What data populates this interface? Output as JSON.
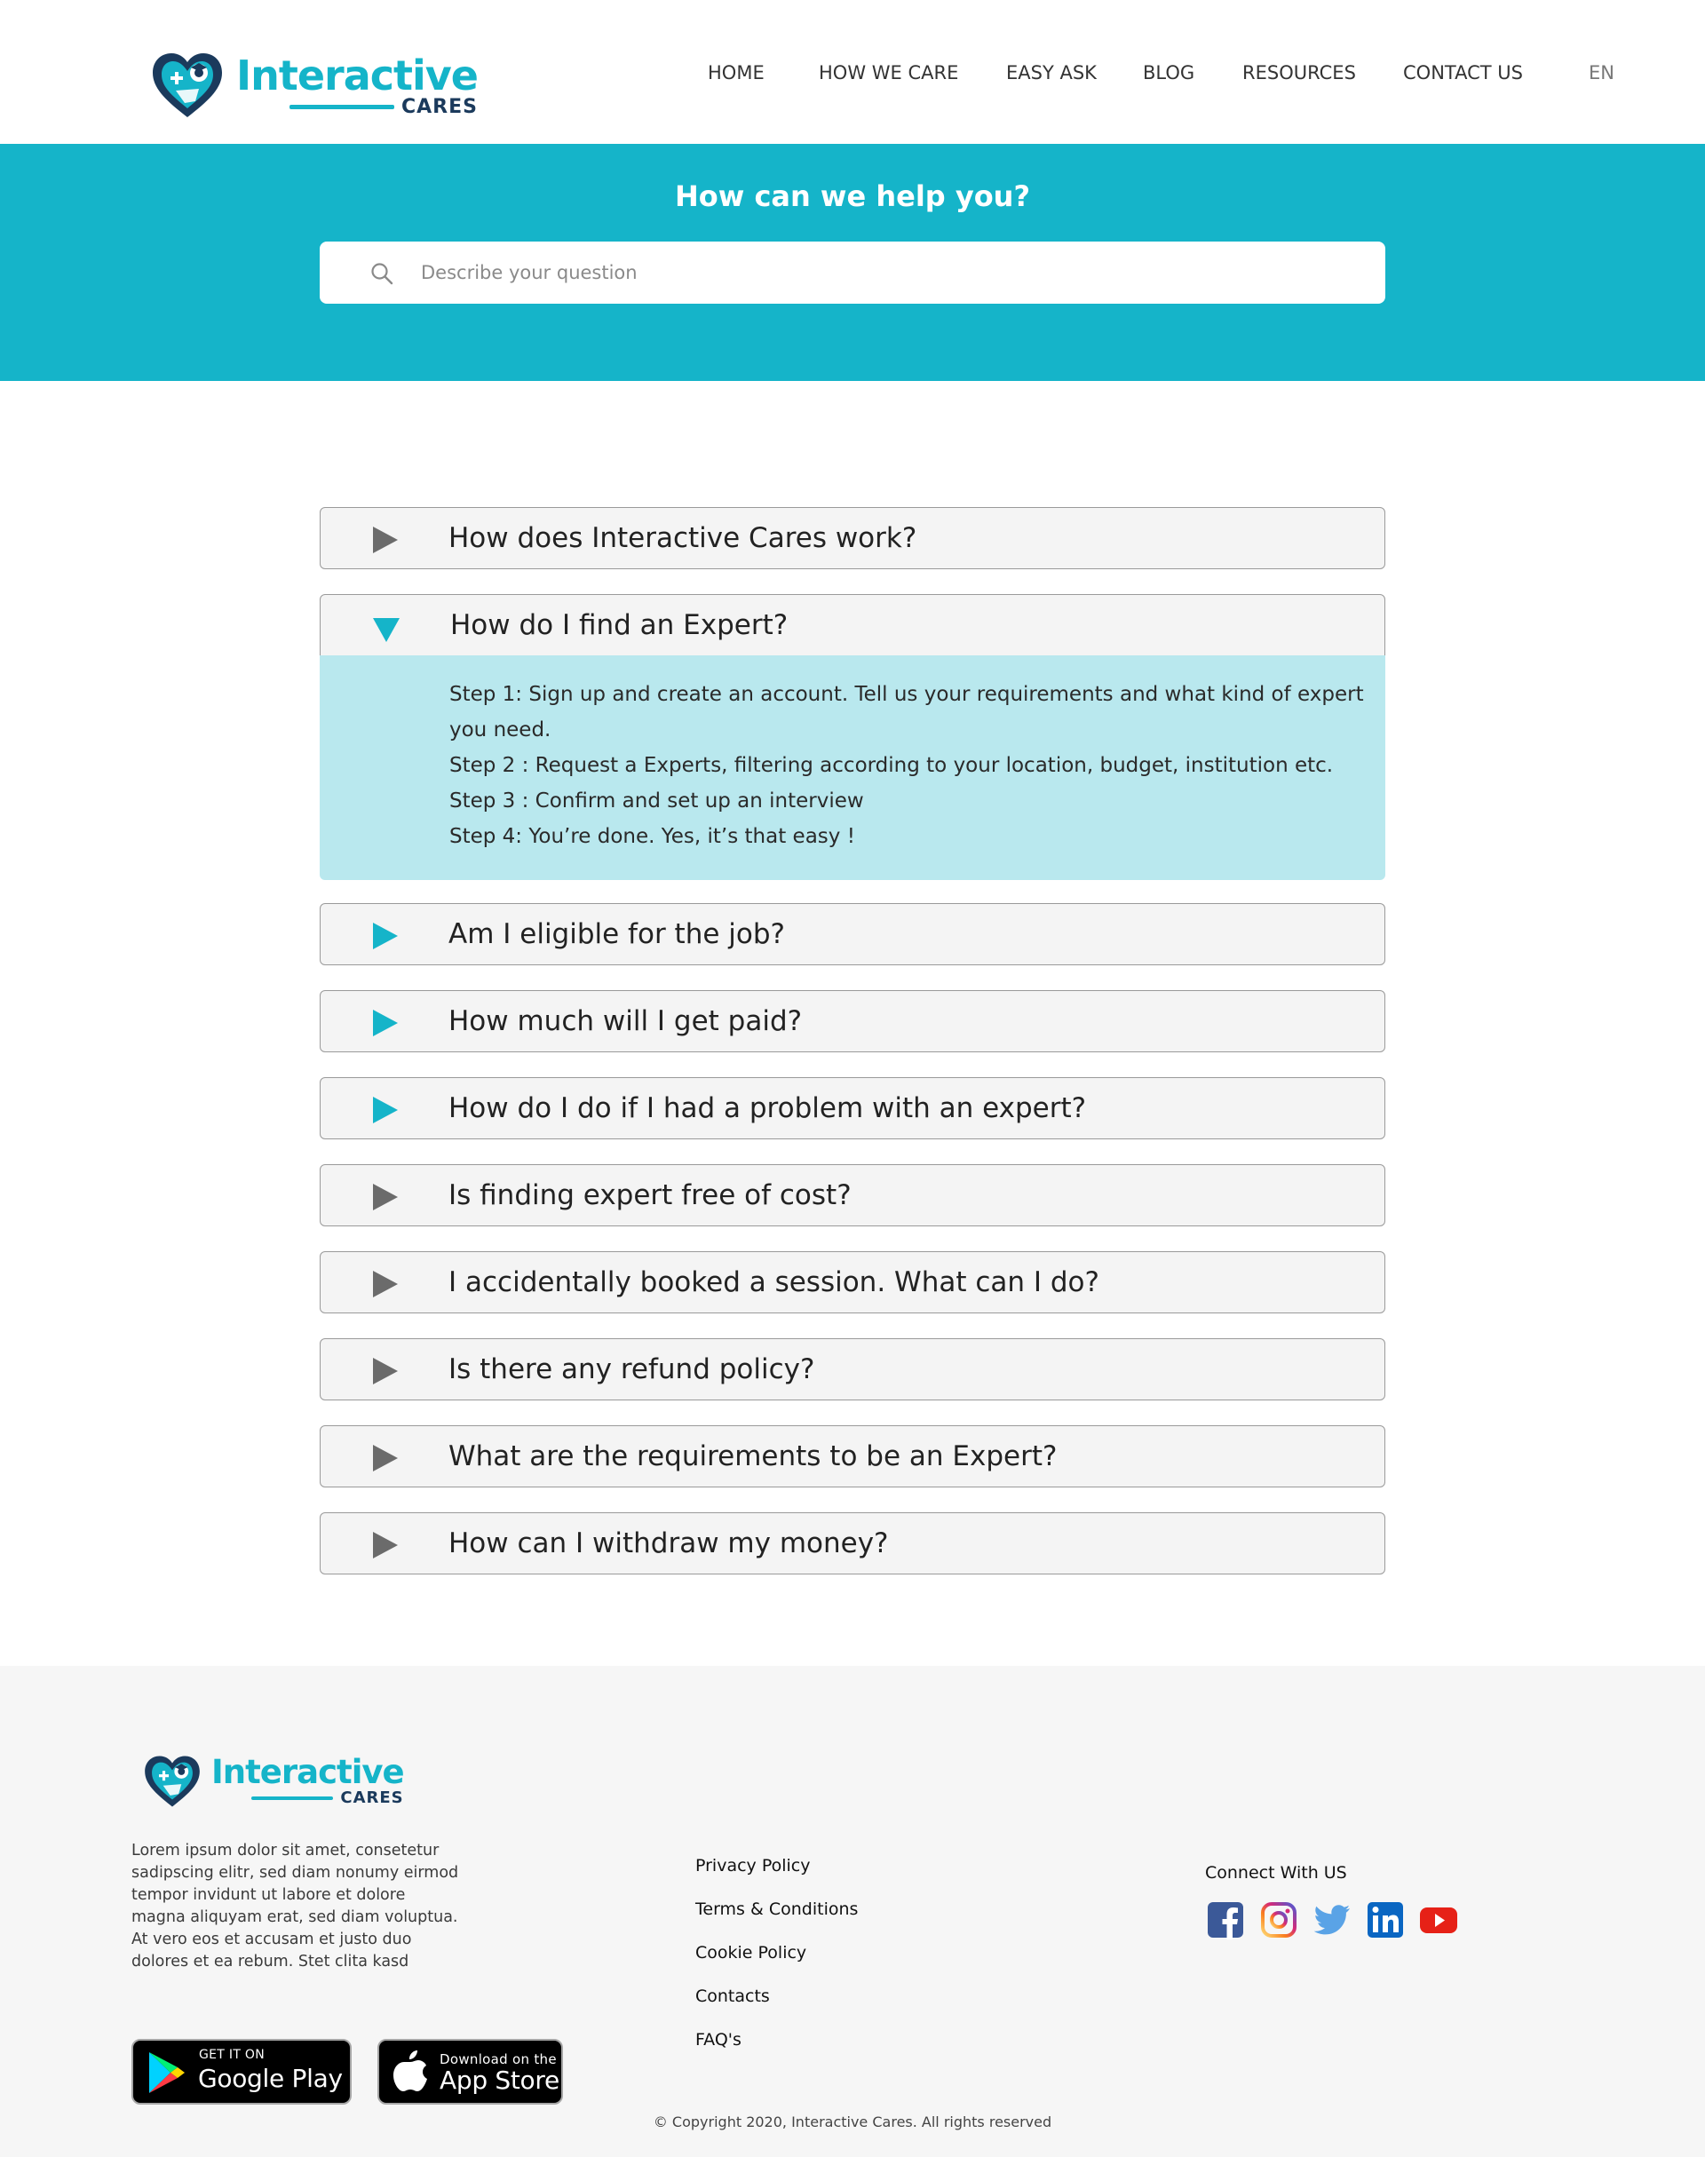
{
  "brand": {
    "logo_word": "Interactive",
    "logo_sub": "CARES",
    "primary_color": "#15b4c9",
    "dark_color": "#1b3a5c"
  },
  "nav": {
    "items": [
      "HOME",
      "HOW WE CARE",
      "EASY ASK",
      "BLOG",
      "RESOURCES",
      "CONTACT US"
    ],
    "language": "EN"
  },
  "hero": {
    "title": "How can we help you?",
    "search_placeholder": "Describe your question",
    "search_icon": "search-icon"
  },
  "faq": {
    "items": [
      {
        "question": "How does Interactive Cares work?",
        "arrow": "play-icon",
        "arrow_color": "#6b6b6b",
        "open": false
      },
      {
        "question": "How do I find an Expert?",
        "arrow": "caret-down-icon",
        "arrow_color": "#15b4c9",
        "open": true
      },
      {
        "question": "Am I eligible for the job?",
        "arrow": "play-icon",
        "arrow_color": "#15b4c9",
        "open": false
      },
      {
        "question": "How much will I get paid?",
        "arrow": "play-icon",
        "arrow_color": "#15b4c9",
        "open": false
      },
      {
        "question": "How do I do if I had a problem with an expert?",
        "arrow": "play-icon",
        "arrow_color": "#15b4c9",
        "open": false
      },
      {
        "question": "Is finding expert free of cost?",
        "arrow": "play-icon",
        "arrow_color": "#6b6b6b",
        "open": false
      },
      {
        "question": "I accidentally booked a session. What can I do?",
        "arrow": "play-icon",
        "arrow_color": "#6b6b6b",
        "open": false
      },
      {
        "question": "Is there any refund policy?",
        "arrow": "play-icon",
        "arrow_color": "#6b6b6b",
        "open": false
      },
      {
        "question": "What are the requirements to be an Expert?",
        "arrow": "play-icon",
        "arrow_color": "#6b6b6b",
        "open": false
      },
      {
        "question": "How can I withdraw my money?",
        "arrow": "play-icon",
        "arrow_color": "#6b6b6b",
        "open": false
      }
    ],
    "open_answer": [
      "Step 1: Sign up and create an account. Tell us your requirements and what kind of expert you need.",
      "Step 2 : Request a Experts, filtering according to your location, budget, institution etc.",
      "Step 3 : Confirm and set up an interview",
      "Step 4: You’re done. Yes, it’s that easy !"
    ]
  },
  "footer": {
    "about": "Lorem ipsum dolor sit amet, consetetur sadipscing elitr, sed diam nonumy eirmod tempor invidunt ut labore et dolore magna aliquyam erat, sed diam voluptua. At vero eos et accusam et justo duo dolores et ea rebum. Stet clita kasd",
    "google_play": {
      "small": "GET IT ON",
      "big": "Google Play"
    },
    "app_store": {
      "small": "Download on the",
      "big": "App Store"
    },
    "links": [
      "Privacy Policy",
      "Terms & Conditions",
      "Cookie Policy",
      "Contacts",
      "FAQ's"
    ],
    "connect_title": "Connect With US",
    "socials": [
      {
        "name": "facebook-icon",
        "color": "#3b5998"
      },
      {
        "name": "instagram-icon",
        "color": "#c13584"
      },
      {
        "name": "twitter-icon",
        "color": "#5aa3e6"
      },
      {
        "name": "linkedin-icon",
        "color": "#0a66c2"
      },
      {
        "name": "youtube-icon",
        "color": "#e62117"
      }
    ],
    "copyright": "© Copyright 2020, Interactive Cares. All rights reserved"
  }
}
